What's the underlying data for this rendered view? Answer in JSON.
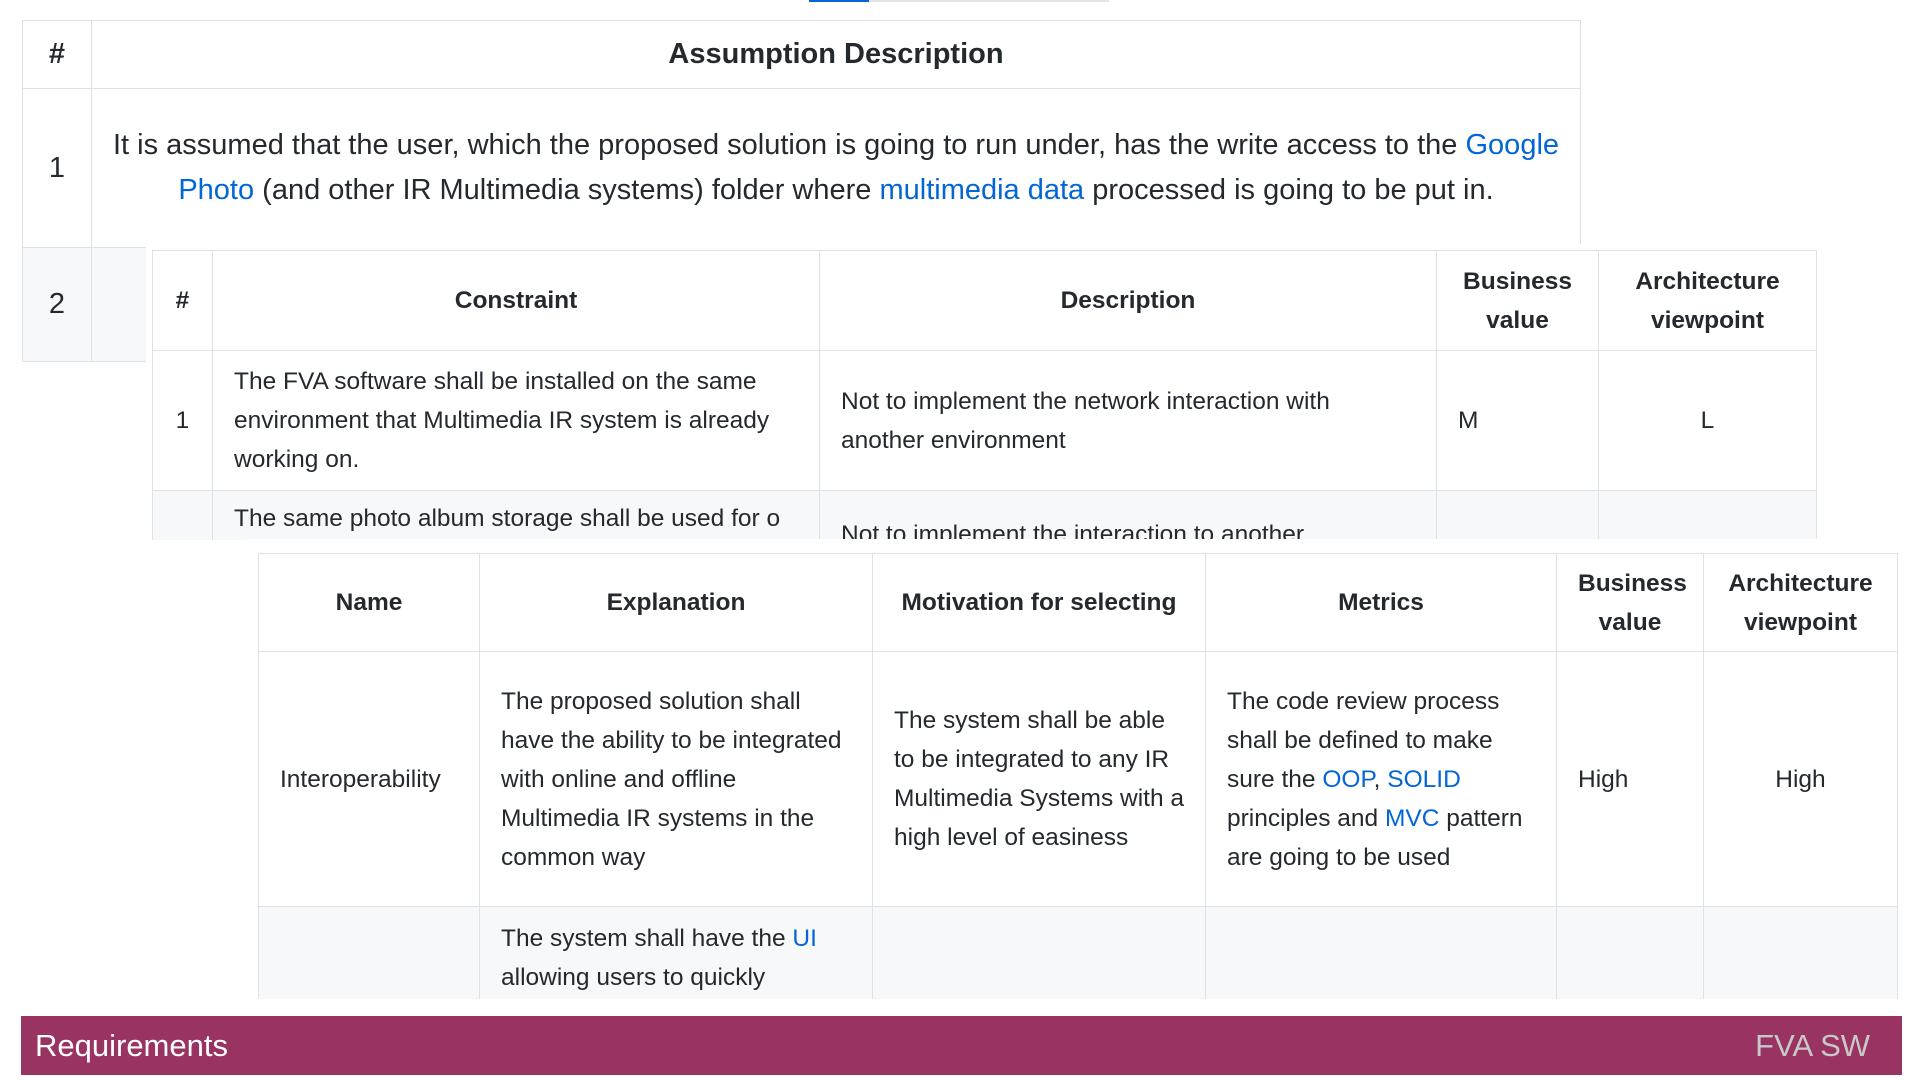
{
  "assumptions": {
    "headers": [
      "#",
      "Assumption Description"
    ],
    "rows": [
      {
        "num": "1",
        "text_a": "It is assumed that the user, which the proposed solution is going to run under, has the write access to the ",
        "link1": "Google Photo",
        "text_b": " (and other IR Multimedia systems) folder where ",
        "link2": "multimedia data",
        "text_c": " processed is going to be put in."
      },
      {
        "num": "2"
      }
    ]
  },
  "constraints": {
    "headers": [
      "#",
      "Constraint",
      "Description",
      "Business value",
      "Architecture viewpoint"
    ],
    "rows": [
      {
        "num": "1",
        "constraint": "The FVA software shall be installed on the same environment that Multimedia IR system is already working on.",
        "description": "Not to implement the network interaction with another environment",
        "business_value": "M",
        "architecture_viewpoint": "L"
      },
      {
        "num": "2",
        "constraint": "The same photo album storage shall be used for o F",
        "description": "Not to implement the interaction to another",
        "business_value": "",
        "architecture_viewpoint": ""
      }
    ]
  },
  "quality_attributes": {
    "headers": [
      "Name",
      "Explanation",
      "Motivation for selecting",
      "Metrics",
      "Business value",
      "Architecture viewpoint"
    ],
    "rows": [
      {
        "name": "Interoperability",
        "explanation": "The proposed solution shall have the ability to be integrated with online and offline Multimedia IR systems in the common way",
        "motivation": "The system shall be able to be integrated to any IR Multimedia Systems with a high level of easiness",
        "metrics_a": "The code review process shall be defined to make sure the ",
        "metrics_link1": "OOP",
        "metrics_sep": ", ",
        "metrics_link2": "SOLID",
        "metrics_b": " principles and ",
        "metrics_link3": "MVC",
        "metrics_c": " pattern are going to be used",
        "business_value": "High",
        "architecture_viewpoint": "High"
      },
      {
        "explanation_a": "The system shall have the ",
        "explanation_link": "UI",
        "explanation_b": " allowing users to quickly"
      }
    ]
  },
  "footer": {
    "section": "Requirements",
    "product": "FVA SW"
  },
  "colors": {
    "footer_bg": "#993362",
    "link": "#0366d6",
    "border": "#dfe2e5",
    "stripe": "#f6f8fa"
  }
}
